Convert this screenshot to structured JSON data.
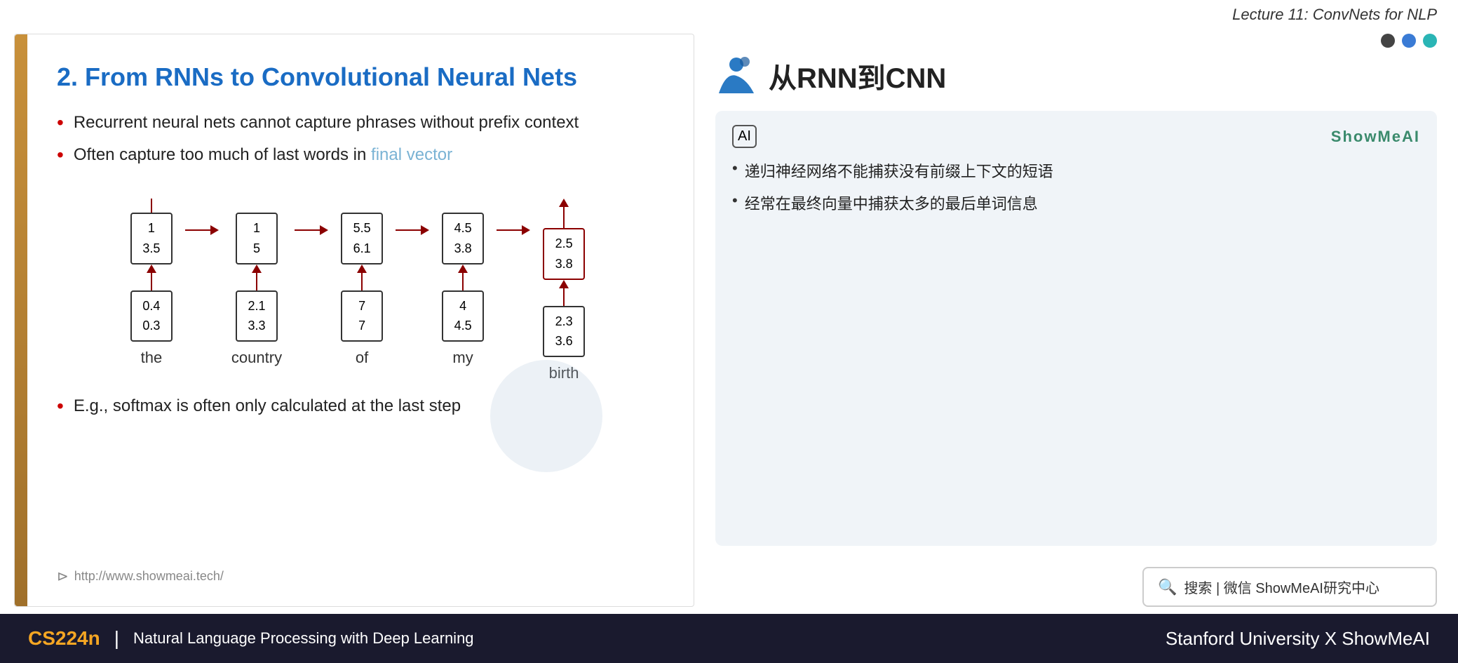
{
  "header": {
    "lecture_title": "Lecture 11: ConvNets for NLP"
  },
  "slide": {
    "left_bar_color": "#b5722a",
    "title": "2. From RNNs to Convolutional Neural Nets",
    "bullets": [
      {
        "text_normal": "Recurrent neural nets cannot capture phrases without prefix context",
        "highlight": ""
      },
      {
        "text_normal": "Often capture too much of last words in ",
        "highlight": "final vector"
      }
    ],
    "rnn_words": [
      "the",
      "country",
      "of",
      "my",
      "birth"
    ],
    "rnn_vectors_top": [
      [
        "1",
        "3.5"
      ],
      [
        "1",
        "5"
      ],
      [
        "5.5",
        "6.1"
      ],
      [
        "4.5",
        "3.8"
      ],
      [
        "2.5",
        "3.8"
      ]
    ],
    "rnn_vectors_bottom": [
      [
        "0.4",
        "0.3"
      ],
      [
        "2.1",
        "3.3"
      ],
      [
        "7",
        "7"
      ],
      [
        "4",
        "4.5"
      ],
      [
        "2.3",
        "3.6"
      ]
    ],
    "bullet3": "E.g., softmax is often only calculated at the last step",
    "url": "http://www.showmeai.tech/"
  },
  "right_panel": {
    "dots": [
      "dark",
      "blue",
      "teal"
    ],
    "chinese_title": "从RNN到CNN",
    "card": {
      "ai_icon": "AI",
      "brand": "ShowMeAI",
      "bullets": [
        "递归神经网络不能捕获没有前缀上下文的短语",
        "经常在最终向量中捕获太多的最后单词信息"
      ]
    },
    "search_placeholder": "搜索 | 微信 ShowMeAI研究中心"
  },
  "footer": {
    "course_code": "CS224n",
    "divider": "|",
    "course_title": "Natural Language Processing with Deep Learning",
    "right_text": "Stanford University X ShowMeAI"
  }
}
